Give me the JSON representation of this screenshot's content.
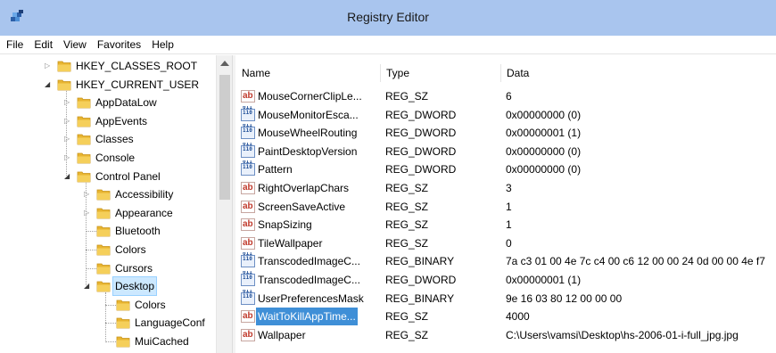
{
  "window": {
    "title": "Registry Editor",
    "icon": "registry-editor-icon"
  },
  "menubar": {
    "items": [
      "File",
      "Edit",
      "View",
      "Favorites",
      "Help"
    ]
  },
  "tree": {
    "nodes": [
      {
        "label": "HKEY_CLASSES_ROOT",
        "state": "collapsed"
      },
      {
        "label": "HKEY_CURRENT_USER",
        "state": "expanded"
      },
      {
        "label": "AppDataLow",
        "state": "collapsed"
      },
      {
        "label": "AppEvents",
        "state": "collapsed"
      },
      {
        "label": "Classes",
        "state": "collapsed"
      },
      {
        "label": "Console",
        "state": "collapsed"
      },
      {
        "label": "Control Panel",
        "state": "expanded"
      },
      {
        "label": "Accessibility",
        "state": "collapsed"
      },
      {
        "label": "Appearance",
        "state": "collapsed"
      },
      {
        "label": "Bluetooth",
        "state": "leaf"
      },
      {
        "label": "Colors",
        "state": "leaf"
      },
      {
        "label": "Cursors",
        "state": "leaf"
      },
      {
        "label": "Desktop",
        "state": "expanded",
        "selected": true
      },
      {
        "label": "Colors",
        "state": "leaf"
      },
      {
        "label": "LanguageConf",
        "state": "leaf"
      },
      {
        "label": "MuiCached",
        "state": "leaf"
      }
    ]
  },
  "list": {
    "columns": [
      "Name",
      "Type",
      "Data"
    ],
    "rows": [
      {
        "icon": "sz",
        "name": "MouseCornerClipLe...",
        "type": "REG_SZ",
        "data": "6"
      },
      {
        "icon": "bin",
        "name": "MouseMonitorEsca...",
        "type": "REG_DWORD",
        "data": "0x00000000 (0)"
      },
      {
        "icon": "bin",
        "name": "MouseWheelRouting",
        "type": "REG_DWORD",
        "data": "0x00000001 (1)"
      },
      {
        "icon": "bin",
        "name": "PaintDesktopVersion",
        "type": "REG_DWORD",
        "data": "0x00000000 (0)"
      },
      {
        "icon": "bin",
        "name": "Pattern",
        "type": "REG_DWORD",
        "data": "0x00000000 (0)"
      },
      {
        "icon": "sz",
        "name": "RightOverlapChars",
        "type": "REG_SZ",
        "data": "3"
      },
      {
        "icon": "sz",
        "name": "ScreenSaveActive",
        "type": "REG_SZ",
        "data": "1"
      },
      {
        "icon": "sz",
        "name": "SnapSizing",
        "type": "REG_SZ",
        "data": "1"
      },
      {
        "icon": "sz",
        "name": "TileWallpaper",
        "type": "REG_SZ",
        "data": "0"
      },
      {
        "icon": "bin",
        "name": "TranscodedImageC...",
        "type": "REG_BINARY",
        "data": "7a c3 01 00 4e 7c c4 00 c6 12 00 00 24 0d 00 00 4e f7"
      },
      {
        "icon": "bin",
        "name": "TranscodedImageC...",
        "type": "REG_DWORD",
        "data": "0x00000001 (1)"
      },
      {
        "icon": "bin",
        "name": "UserPreferencesMask",
        "type": "REG_BINARY",
        "data": "9e 16 03 80 12 00 00 00"
      },
      {
        "icon": "sz",
        "name": "WaitToKillAppTime...",
        "type": "REG_SZ",
        "data": "4000",
        "selected": true
      },
      {
        "icon": "sz",
        "name": "Wallpaper",
        "type": "REG_SZ",
        "data": "C:\\Users\\vamsi\\Desktop\\hs-2006-01-i-full_jpg.jpg"
      }
    ]
  },
  "icon_labels": {
    "sz": "ab",
    "bin": "011 110"
  },
  "colors": {
    "titlebar": "#a9c5ee",
    "selection": "#3f8fd7",
    "tree_selection": "#cce8ff",
    "folder": "#e8b531"
  }
}
